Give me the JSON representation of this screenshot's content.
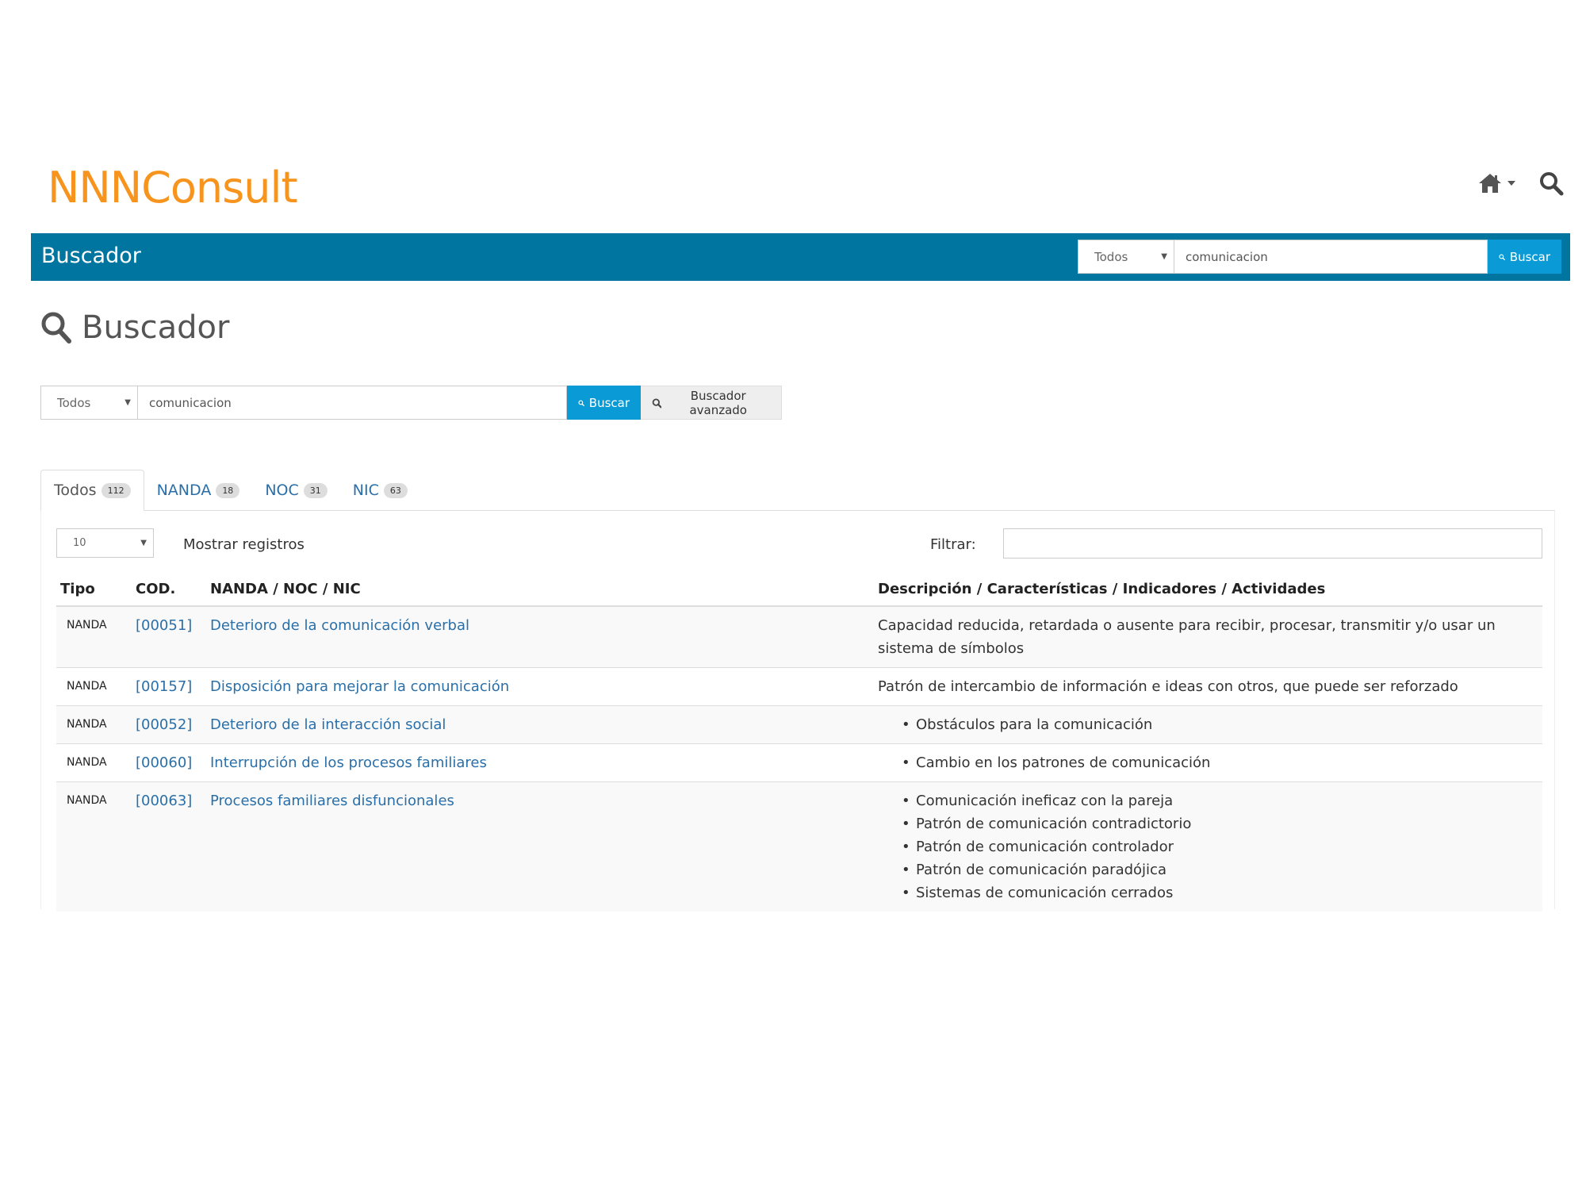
{
  "header": {
    "logo": "NNNConsult"
  },
  "bluebar": {
    "title": "Buscador",
    "search": {
      "select_value": "Todos",
      "input_value": "comunicacion",
      "button_label": "Buscar"
    }
  },
  "page": {
    "title": "Buscador"
  },
  "main_search": {
    "select_value": "Todos",
    "input_value": "comunicacion",
    "button_label": "Buscar",
    "advanced_label": "Buscador avanzado"
  },
  "tabs": [
    {
      "label": "Todos",
      "count": "112"
    },
    {
      "label": "NANDA",
      "count": "18"
    },
    {
      "label": "NOC",
      "count": "31"
    },
    {
      "label": "NIC",
      "count": "63"
    }
  ],
  "table_controls": {
    "length_value": "10",
    "length_label": "Mostrar registros",
    "filter_label": "Filtrar:"
  },
  "table": {
    "headers": [
      "Tipo",
      "COD.",
      "NANDA / NOC / NIC",
      "Descripción / Características / Indicadores / Actividades"
    ],
    "rows": [
      {
        "tipo": "NANDA",
        "code": "[00051]",
        "name": "Deterioro de la comunicación verbal",
        "desc": "Capacidad reducida, retardada o ausente para recibir, procesar, transmitir y/o usar un sistema de símbolos"
      },
      {
        "tipo": "NANDA",
        "code": "[00157]",
        "name": "Disposición para mejorar la comunicación",
        "desc": "Patrón de intercambio de información e ideas con otros, que puede ser reforzado"
      },
      {
        "tipo": "NANDA",
        "code": "[00052]",
        "name": "Deterioro de la interacción social",
        "items": [
          "Obstáculos para la comunicación"
        ]
      },
      {
        "tipo": "NANDA",
        "code": "[00060]",
        "name": "Interrupción de los procesos familiares",
        "items": [
          "Cambio en los patrones de comunicación"
        ]
      },
      {
        "tipo": "NANDA",
        "code": "[00063]",
        "name": "Procesos familiares disfuncionales",
        "items": [
          "Comunicación ineficaz con la pareja",
          "Patrón de comunicación contradictorio",
          "Patrón de comunicación controlador",
          "Patrón de comunicación paradójica",
          "Sistemas de comunicación cerrados"
        ]
      }
    ]
  },
  "icons": {
    "home": "home-icon",
    "search": "search-icon",
    "caret": "chevron-down-icon"
  },
  "colors": {
    "logo": "#f7941d",
    "bar": "#00759f",
    "button": "#0a9bd6",
    "link": "#2a6fa8"
  }
}
